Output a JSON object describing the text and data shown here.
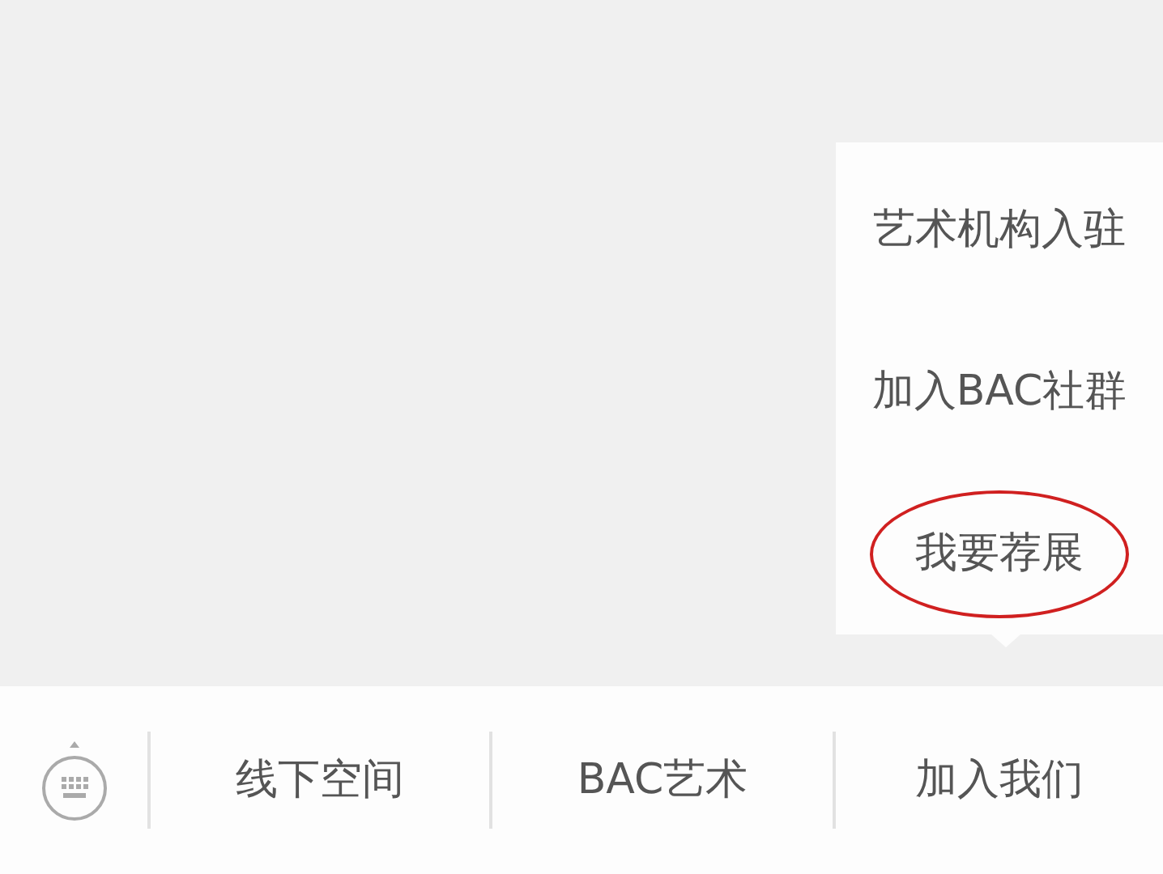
{
  "menu": {
    "items": [
      {
        "label": "艺术机构入驻",
        "circled": false
      },
      {
        "label": "加入BAC社群",
        "circled": false
      },
      {
        "label": "我要荐展",
        "circled": true
      }
    ]
  },
  "bottom_bar": {
    "tabs": [
      {
        "label": "线下空间"
      },
      {
        "label": "BAC艺术"
      },
      {
        "label": "加入我们"
      }
    ]
  }
}
